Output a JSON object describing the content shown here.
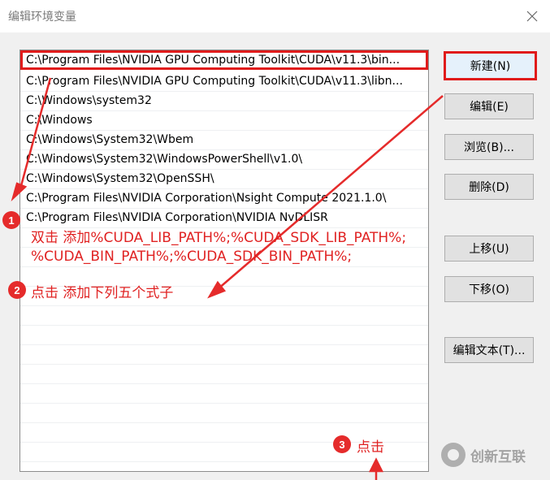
{
  "window": {
    "title": "编辑环境变量",
    "close_icon": "close-icon"
  },
  "list": {
    "rows": [
      "C:\\Program Files\\NVIDIA GPU Computing Toolkit\\CUDA\\v11.3\\bin...",
      "C:\\Program Files\\NVIDIA GPU Computing Toolkit\\CUDA\\v11.3\\libn...",
      "C:\\Windows\\system32",
      "C:\\Windows",
      "C:\\Windows\\System32\\Wbem",
      "C:\\Windows\\System32\\WindowsPowerShell\\v1.0\\",
      "C:\\Windows\\System32\\OpenSSH\\",
      "C:\\Program Files\\NVIDIA Corporation\\Nsight Compute 2021.1.0\\",
      "C:\\Program Files\\NVIDIA Corporation\\NVIDIA NvDLISR"
    ],
    "selected_index": 0
  },
  "buttons": {
    "new": "新建(N)",
    "edit": "编辑(E)",
    "browse": "浏览(B)...",
    "delete": "删除(D)",
    "move_up": "上移(U)",
    "move_down": "下移(O)",
    "edit_text": "编辑文本(T)..."
  },
  "annotations": {
    "step1_number": "1",
    "step1_line1": "双击 添加%CUDA_LIB_PATH%;%CUDA_SDK_LIB_PATH%;",
    "step1_line2": "%CUDA_BIN_PATH%;%CUDA_SDK_BIN_PATH%;",
    "step2_number": "2",
    "step2_text": "点击 添加下列五个式子",
    "step3_number": "3",
    "step3_text": "点击",
    "color": "#e02222"
  },
  "watermark": {
    "text": "创新互联"
  }
}
